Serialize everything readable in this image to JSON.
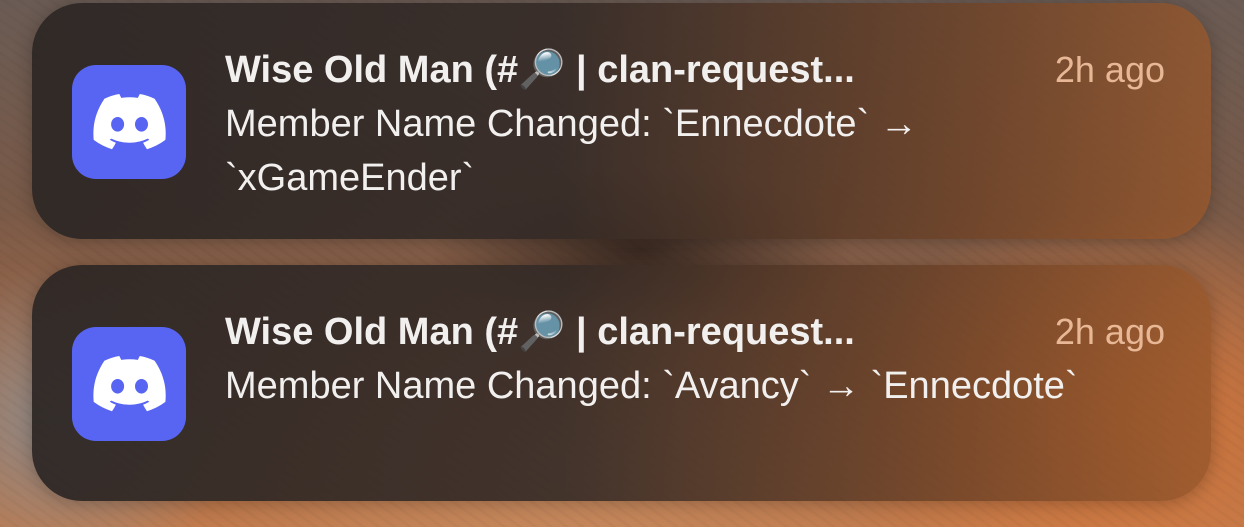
{
  "notifications": [
    {
      "app_icon": "discord-icon",
      "title": "Wise Old Man (#🔎 | clan-request...",
      "timestamp": "2h ago",
      "message": "Member Name Changed: `Ennecdote` → `xGameEnder`"
    },
    {
      "app_icon": "discord-icon",
      "title": "Wise Old Man (#🔎 | clan-request...",
      "timestamp": "2h ago",
      "message": "Member Name Changed: `Avancy` → `Ennecdote`"
    }
  ],
  "colors": {
    "discord_brand": "#5865f2",
    "timestamp": "#e8b896",
    "text": "#f2f0ef"
  }
}
